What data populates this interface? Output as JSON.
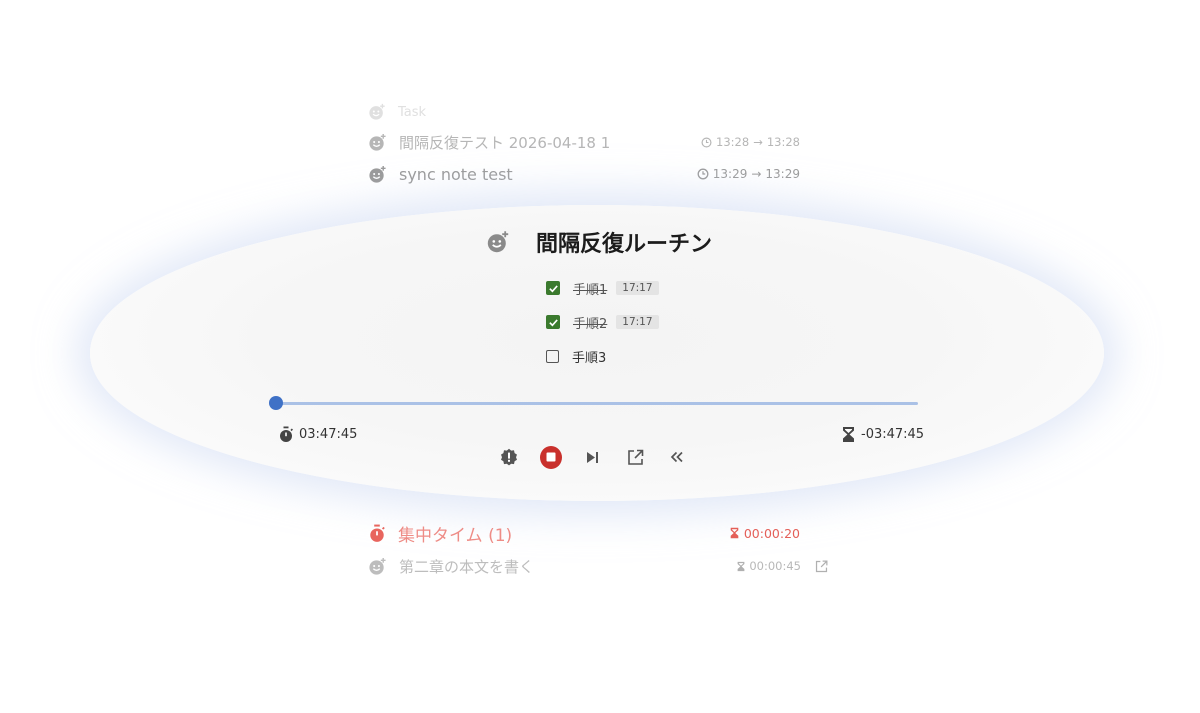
{
  "list_above": [
    {
      "title": "Task"
    },
    {
      "title": "間隔反復テスト 2026-04-18 1",
      "start": "13:28",
      "arrow": "→",
      "end": "13:28"
    },
    {
      "title": "sync note test",
      "start": "13:29",
      "arrow": "→",
      "end": "13:29"
    }
  ],
  "focus": {
    "title": "間隔反復ルーチン",
    "checklist": [
      {
        "label": "手順1",
        "checked": true,
        "time": "17:17"
      },
      {
        "label": "手順2",
        "checked": true,
        "time": "17:17"
      },
      {
        "label": "手順3",
        "checked": false
      }
    ],
    "progress": 0,
    "elapsed": "03:47:45",
    "remaining": "-03:47:45",
    "controls": [
      "alert-icon",
      "stop-icon",
      "skip-next-icon",
      "open-external-icon",
      "rewind-icon"
    ]
  },
  "list_below": [
    {
      "title": "集中タイム (1)",
      "duration": "00:00:20"
    },
    {
      "title": "第二章の本文を書く",
      "duration": "00:00:45"
    }
  ],
  "colors": {
    "checkbox_checked": "#3b7a2e",
    "stop_button": "#c9302c",
    "slider_knob": "#3f71c6",
    "slider_track": "#aac1e6",
    "running_task": "#ee8c86"
  }
}
